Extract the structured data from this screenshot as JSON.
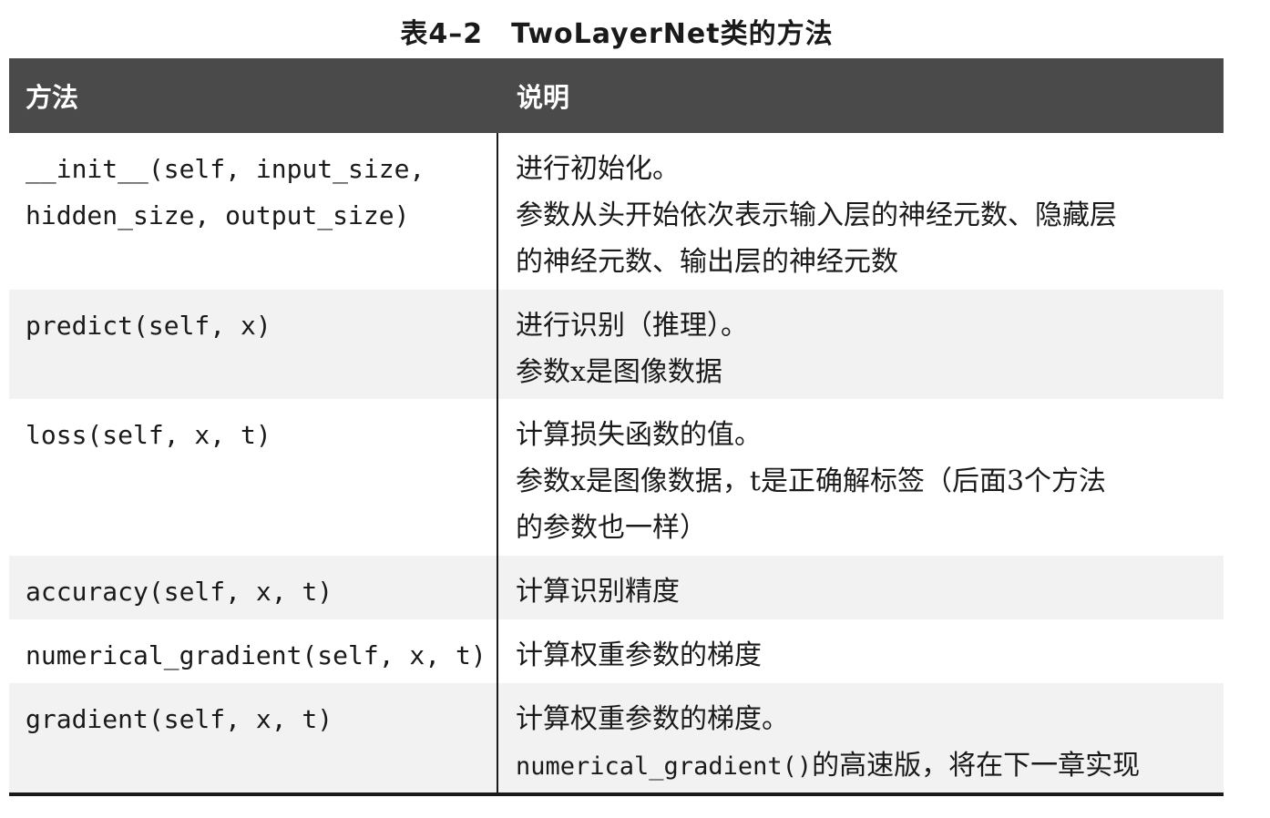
{
  "caption": "表4–2　TwoLayerNet类的方法",
  "header": {
    "col_method": "方法",
    "col_desc": "说明"
  },
  "rows": [
    {
      "method": "__init__(self, input_size, hidden_size, output_size)",
      "desc_lines": [
        "进行初始化。",
        "参数从头开始依次表示输入层的神经元数、隐藏层",
        "的神经元数、输出层的神经元数"
      ]
    },
    {
      "method": "predict(self, x)",
      "desc_lines": [
        "进行识别（推理）。",
        "参数x是图像数据"
      ]
    },
    {
      "method": "loss(self, x, t)",
      "desc_lines": [
        "计算损失函数的值。",
        "参数x是图像数据，t是正确解标签（后面3个方法",
        "的参数也一样）"
      ]
    },
    {
      "method": "accuracy(self, x, t)",
      "desc_lines": [
        "计算识别精度"
      ]
    },
    {
      "method": "numerical_gradient(self, x, t)",
      "desc_lines": [
        "计算权重参数的梯度"
      ]
    },
    {
      "method": "gradient(self, x, t)",
      "desc_lines": [
        "计算权重参数的梯度。"
      ],
      "desc_code": "numerical_gradient()",
      "desc_tail": "的高速版，将在下一章实现"
    }
  ]
}
